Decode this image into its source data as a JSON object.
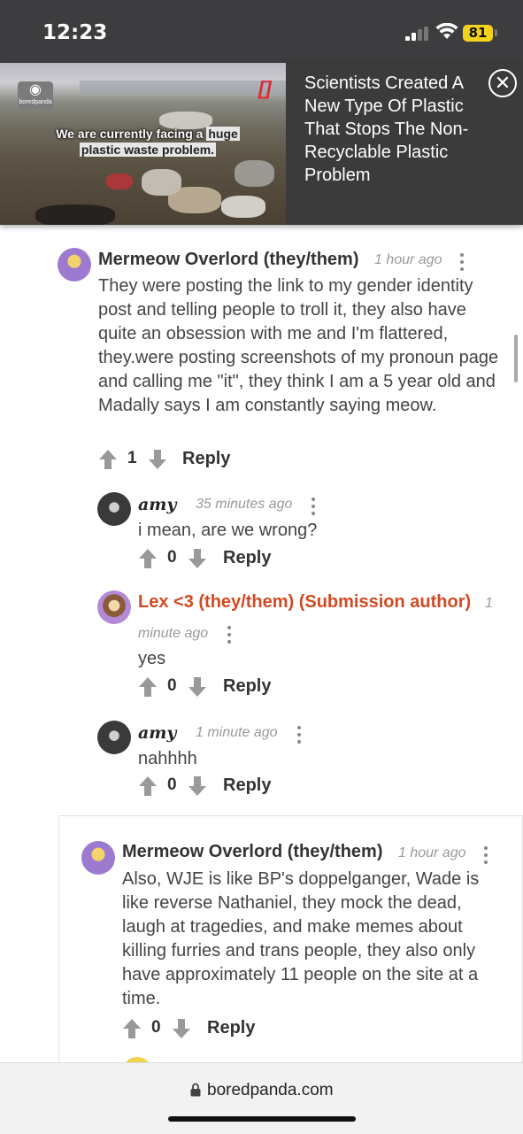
{
  "status_bar": {
    "time": "12:23",
    "battery": "81"
  },
  "ad": {
    "logo_text": "boredpanda",
    "caption_before": "We are currently facing a ",
    "caption_highlight_1": "huge",
    "caption_highlight_2": "plastic waste problem.",
    "title": "Scientists Created A New Type Of Plastic That Stops The Non-Recyclable Plastic Problem",
    "bracket": "[]"
  },
  "comments": [
    {
      "author": "Mermeow Overlord (they/them)",
      "time": "1 hour ago",
      "text": "They were posting the link to my gender identity post and telling people to troll it, they also have quite an obsession with me and I'm flattered, they.were posting screenshots of my pronoun page and calling me \"it\", they think I am a 5 year old and Madally says I am constantly saying meow.",
      "score": "1",
      "reply_label": "Reply"
    },
    {
      "author": "amy",
      "time": "35 minutes ago",
      "text": "i mean, are we wrong?",
      "score": "0",
      "reply_label": "Reply"
    },
    {
      "author": "Lex <3 (they/them) (Submission author)",
      "time_line1": "1",
      "time_line2": "minute ago",
      "text": "yes",
      "score": "0",
      "reply_label": "Reply"
    },
    {
      "author": "amy",
      "time": "1 minute ago",
      "text": "nahhhh",
      "score": "0",
      "reply_label": "Reply"
    },
    {
      "author": "Mermeow Overlord (they/them)",
      "time": "1 hour ago",
      "text": "Also, WJE is like BP's doppelganger, Wade is like reverse Nathaniel, they mock the dead, laugh at tragedies, and make memes about killing furries and trans people, they also only have approximately 11 people on the site at a time.",
      "score": "0",
      "reply_label": "Reply"
    }
  ],
  "browser": {
    "url": "boredpanda.com"
  },
  "colors": {
    "op_author": "#d24a23",
    "status_bar": "#3d3d3f",
    "battery": "#f3d21b"
  }
}
